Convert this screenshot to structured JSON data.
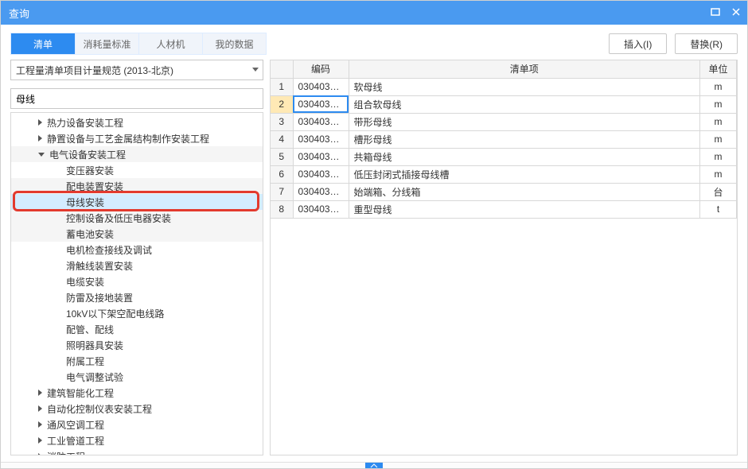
{
  "titlebar": {
    "title": "查询"
  },
  "toolbar": {
    "tabs": [
      "清单",
      "消耗量标准",
      "人材机",
      "我的数据"
    ],
    "active_tab": 0,
    "insert_label": "插入(I)",
    "replace_label": "替换(R)"
  },
  "left": {
    "select_value": "工程量清单项目计量规范 (2013-北京)",
    "search_value": "母线",
    "tree": [
      {
        "level": 1,
        "expander": "right",
        "label": "热力设备安装工程"
      },
      {
        "level": 1,
        "expander": "right",
        "label": "静置设备与工艺金属结构制作安装工程"
      },
      {
        "level": 1,
        "expander": "down",
        "label": "电气设备安装工程",
        "alt": true
      },
      {
        "level": 2,
        "label": "变压器安装"
      },
      {
        "level": 2,
        "label": "配电装置安装",
        "alt": true
      },
      {
        "level": 2,
        "label": "母线安装",
        "highlight": true
      },
      {
        "level": 2,
        "label": "控制设备及低压电器安装",
        "alt": true
      },
      {
        "level": 2,
        "label": "蓄电池安装",
        "alt": true
      },
      {
        "level": 2,
        "label": "电机检查接线及调试"
      },
      {
        "level": 2,
        "label": "滑触线装置安装"
      },
      {
        "level": 2,
        "label": "电缆安装"
      },
      {
        "level": 2,
        "label": "防雷及接地装置"
      },
      {
        "level": 2,
        "label": "10kV以下架空配电线路"
      },
      {
        "level": 2,
        "label": "配管、配线"
      },
      {
        "level": 2,
        "label": "照明器具安装"
      },
      {
        "level": 2,
        "label": "附属工程"
      },
      {
        "level": 2,
        "label": "电气调整试验"
      },
      {
        "level": 1,
        "expander": "right",
        "label": "建筑智能化工程"
      },
      {
        "level": 1,
        "expander": "right",
        "label": "自动化控制仪表安装工程"
      },
      {
        "level": 1,
        "expander": "right",
        "label": "通风空调工程"
      },
      {
        "level": 1,
        "expander": "right",
        "label": "工业管道工程"
      },
      {
        "level": 1,
        "expander": "right",
        "label": "消防工程"
      }
    ]
  },
  "grid": {
    "headers": {
      "num": "",
      "code": "编码",
      "item": "清单项",
      "unit": "单位"
    },
    "rows": [
      {
        "n": "1",
        "code": "030403…",
        "desc": "软母线",
        "unit": "m"
      },
      {
        "n": "2",
        "code": "030403…",
        "desc": "组合软母线",
        "unit": "m",
        "selected": true
      },
      {
        "n": "3",
        "code": "030403…",
        "desc": "带形母线",
        "unit": "m"
      },
      {
        "n": "4",
        "code": "030403…",
        "desc": "槽形母线",
        "unit": "m"
      },
      {
        "n": "5",
        "code": "030403…",
        "desc": "共箱母线",
        "unit": "m"
      },
      {
        "n": "6",
        "code": "030403…",
        "desc": "低压封闭式插接母线槽",
        "unit": "m"
      },
      {
        "n": "7",
        "code": "030403…",
        "desc": "始端箱、分线箱",
        "unit": "台"
      },
      {
        "n": "8",
        "code": "030403…",
        "desc": "重型母线",
        "unit": "t"
      }
    ]
  }
}
